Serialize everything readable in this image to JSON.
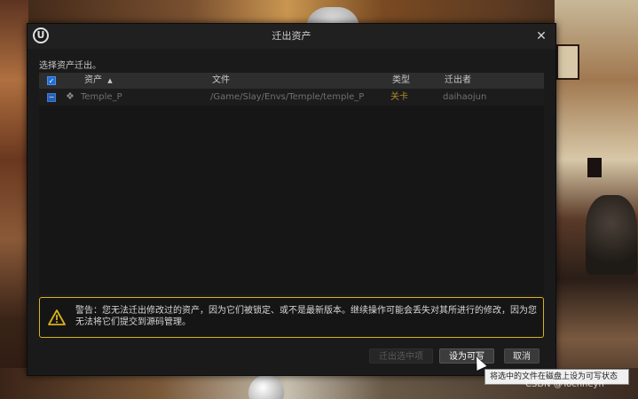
{
  "window": {
    "title": "迁出资产",
    "close_glyph": "✕",
    "logo_glyph": "U"
  },
  "prompt": "选择资产迁出。",
  "table": {
    "columns": [
      "资产",
      "文件",
      "类型",
      "迁出者"
    ],
    "sort_indicator": "▲",
    "rows": [
      {
        "checked": true,
        "asset": "Temple_P",
        "file": "/Game/Slay/Envs/Temple/temple_P",
        "type": "关卡",
        "checked_out_by": "daihaojun"
      }
    ]
  },
  "warning": {
    "text": "警告：您无法迁出修改过的资产，因为它们被锁定、或不是最新版本。继续操作可能会丢失对其所进行的修改，因为您无法将它们提交到源码管理。"
  },
  "buttons": {
    "checkout_selected": "迁出选中项",
    "make_writable": "设为可写",
    "cancel": "取消"
  },
  "tooltip": "将选中的文件在磁盘上设为可写状态",
  "watermark": "CSDN @Tochneyn",
  "colors": {
    "accent_blue": "#1f6fd6",
    "warning_yellow": "#d8b21a",
    "type_gold": "#b08a2a",
    "dialog_bg": "#1a1a1a"
  }
}
